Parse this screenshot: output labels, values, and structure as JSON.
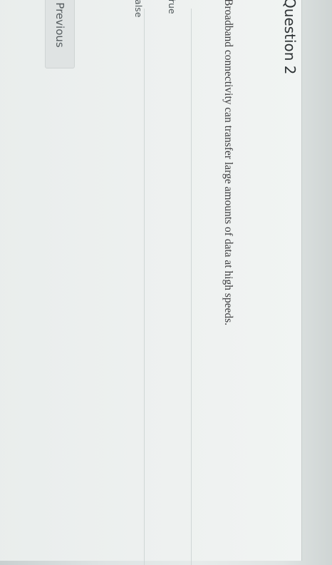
{
  "question": {
    "title": "Question 2",
    "text": "Broadband connectivity can transfer large amounts of data at high speeds."
  },
  "options": [
    {
      "label": "True"
    },
    {
      "label": "False"
    }
  ],
  "navigation": {
    "previous_label": "Previous"
  }
}
